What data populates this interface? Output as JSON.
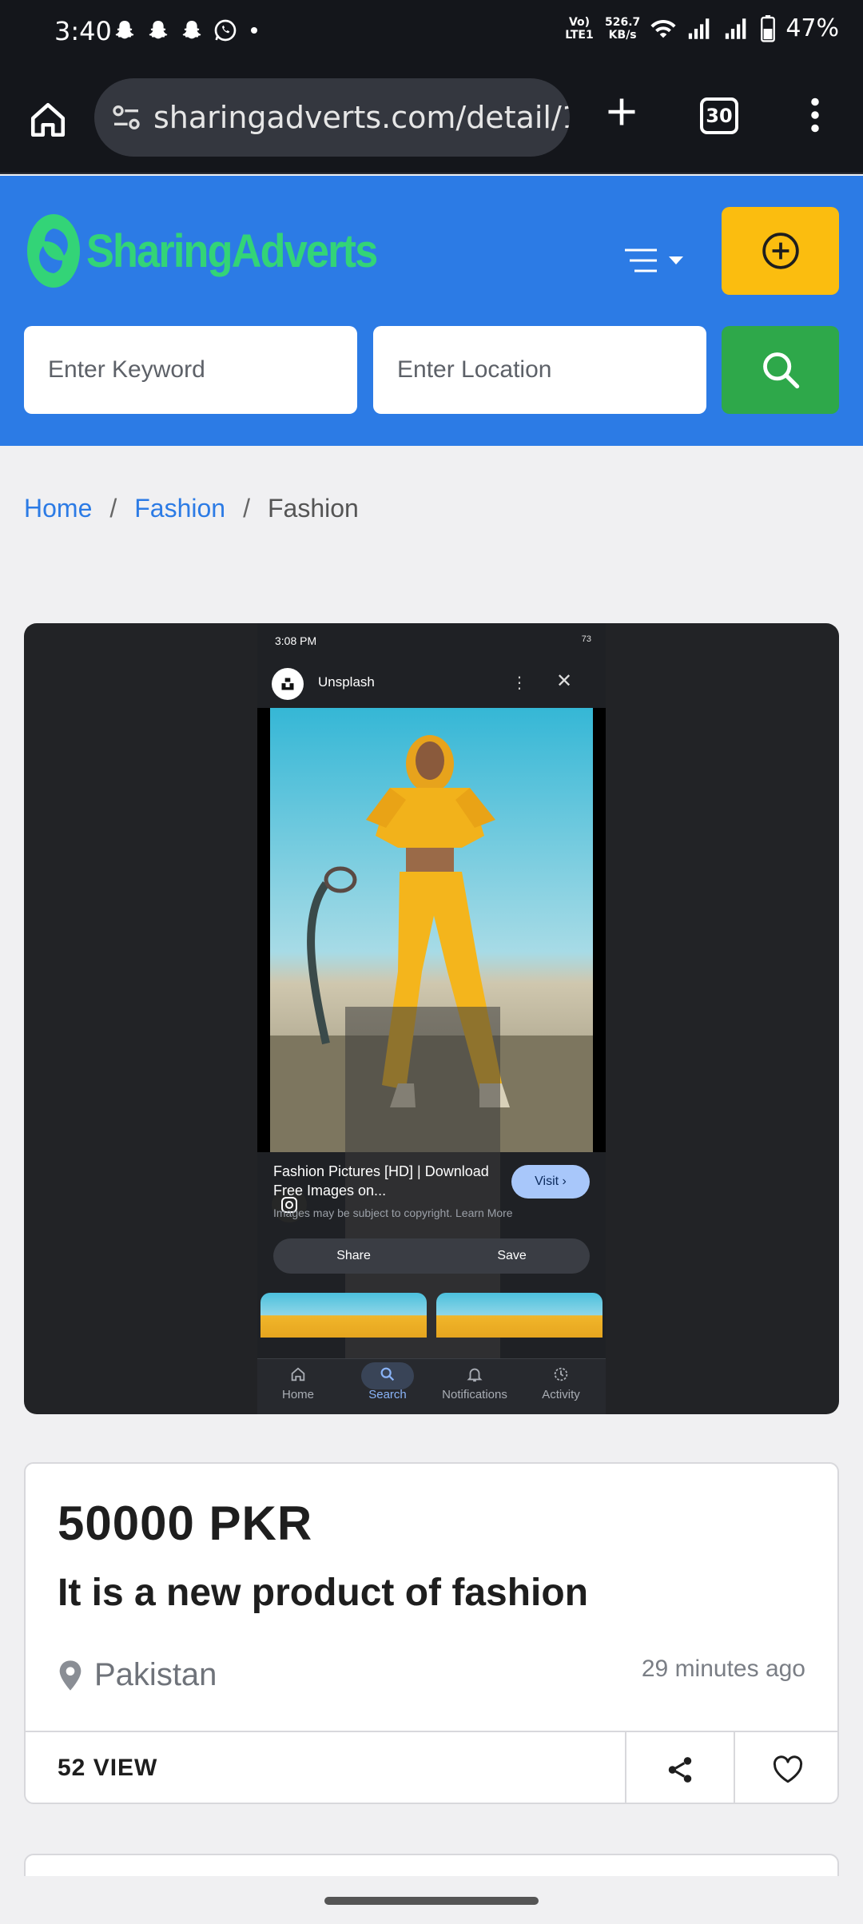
{
  "status_bar": {
    "time": "3:40",
    "network_type": "Vo) LTE1",
    "speed_value": "526.7",
    "speed_unit": "KB/s",
    "battery": "47%",
    "icons": [
      "snapchat-icon",
      "snapchat-icon",
      "snapchat-icon",
      "whatsapp-icon",
      "dot-icon",
      "wifi-icon",
      "signal-icon",
      "signal-icon",
      "battery-icon"
    ]
  },
  "browser": {
    "url": "sharingadverts.com/detail/1",
    "tab_count": "30"
  },
  "site": {
    "logo_text": "SharingAdverts",
    "keyword_placeholder": "Enter Keyword",
    "location_placeholder": "Enter Location"
  },
  "breadcrumb": {
    "items": [
      "Home",
      "Fashion",
      "Fashion"
    ],
    "separator": "/"
  },
  "embedded_screenshot": {
    "time": "3:08 PM",
    "battery": "73",
    "app_title": "Unsplash",
    "caption_title": "Fashion Pictures [HD] | Download Free Images on...",
    "caption_sub": "Images may be subject to copyright. Learn More",
    "visit_label": "Visit",
    "share_label": "Share",
    "save_label": "Save",
    "nav": [
      "Home",
      "Search",
      "Notifications",
      "Activity"
    ]
  },
  "listing": {
    "price": "50000 PKR",
    "title": "It is a new product of fashion",
    "location": "Pakistan",
    "posted": "29 minutes ago",
    "views": "52 VIEW"
  },
  "colors": {
    "brand_blue": "#2c7be5",
    "logo_green": "#33d477",
    "post_yellow": "#fbbd0f",
    "search_green": "#2ea84a"
  }
}
